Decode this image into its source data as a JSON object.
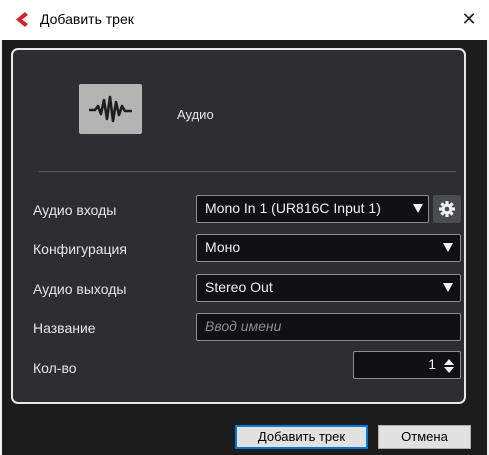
{
  "window": {
    "title": "Добавить трек",
    "close_glyph": "✕"
  },
  "track_type": {
    "label": "Аудио",
    "icon": "audio-waveform-icon"
  },
  "form": {
    "audio_inputs": {
      "label": "Аудио входы",
      "value": "Mono In 1 (UR816C Input 1)"
    },
    "configuration": {
      "label": "Конфигурация",
      "value": "Моно"
    },
    "audio_outputs": {
      "label": "Аудио выходы",
      "value": "Stereo Out"
    },
    "name": {
      "label": "Название",
      "placeholder": "Ввод имени"
    },
    "count": {
      "label": "Кол-во",
      "value": "1"
    }
  },
  "buttons": {
    "add": "Добавить трек",
    "cancel": "Отмена"
  },
  "colors": {
    "panel_bg": "#2e2e32",
    "field_bg": "#111113",
    "accent_border": "#0078d7",
    "app_icon_red": "#d3222a"
  }
}
